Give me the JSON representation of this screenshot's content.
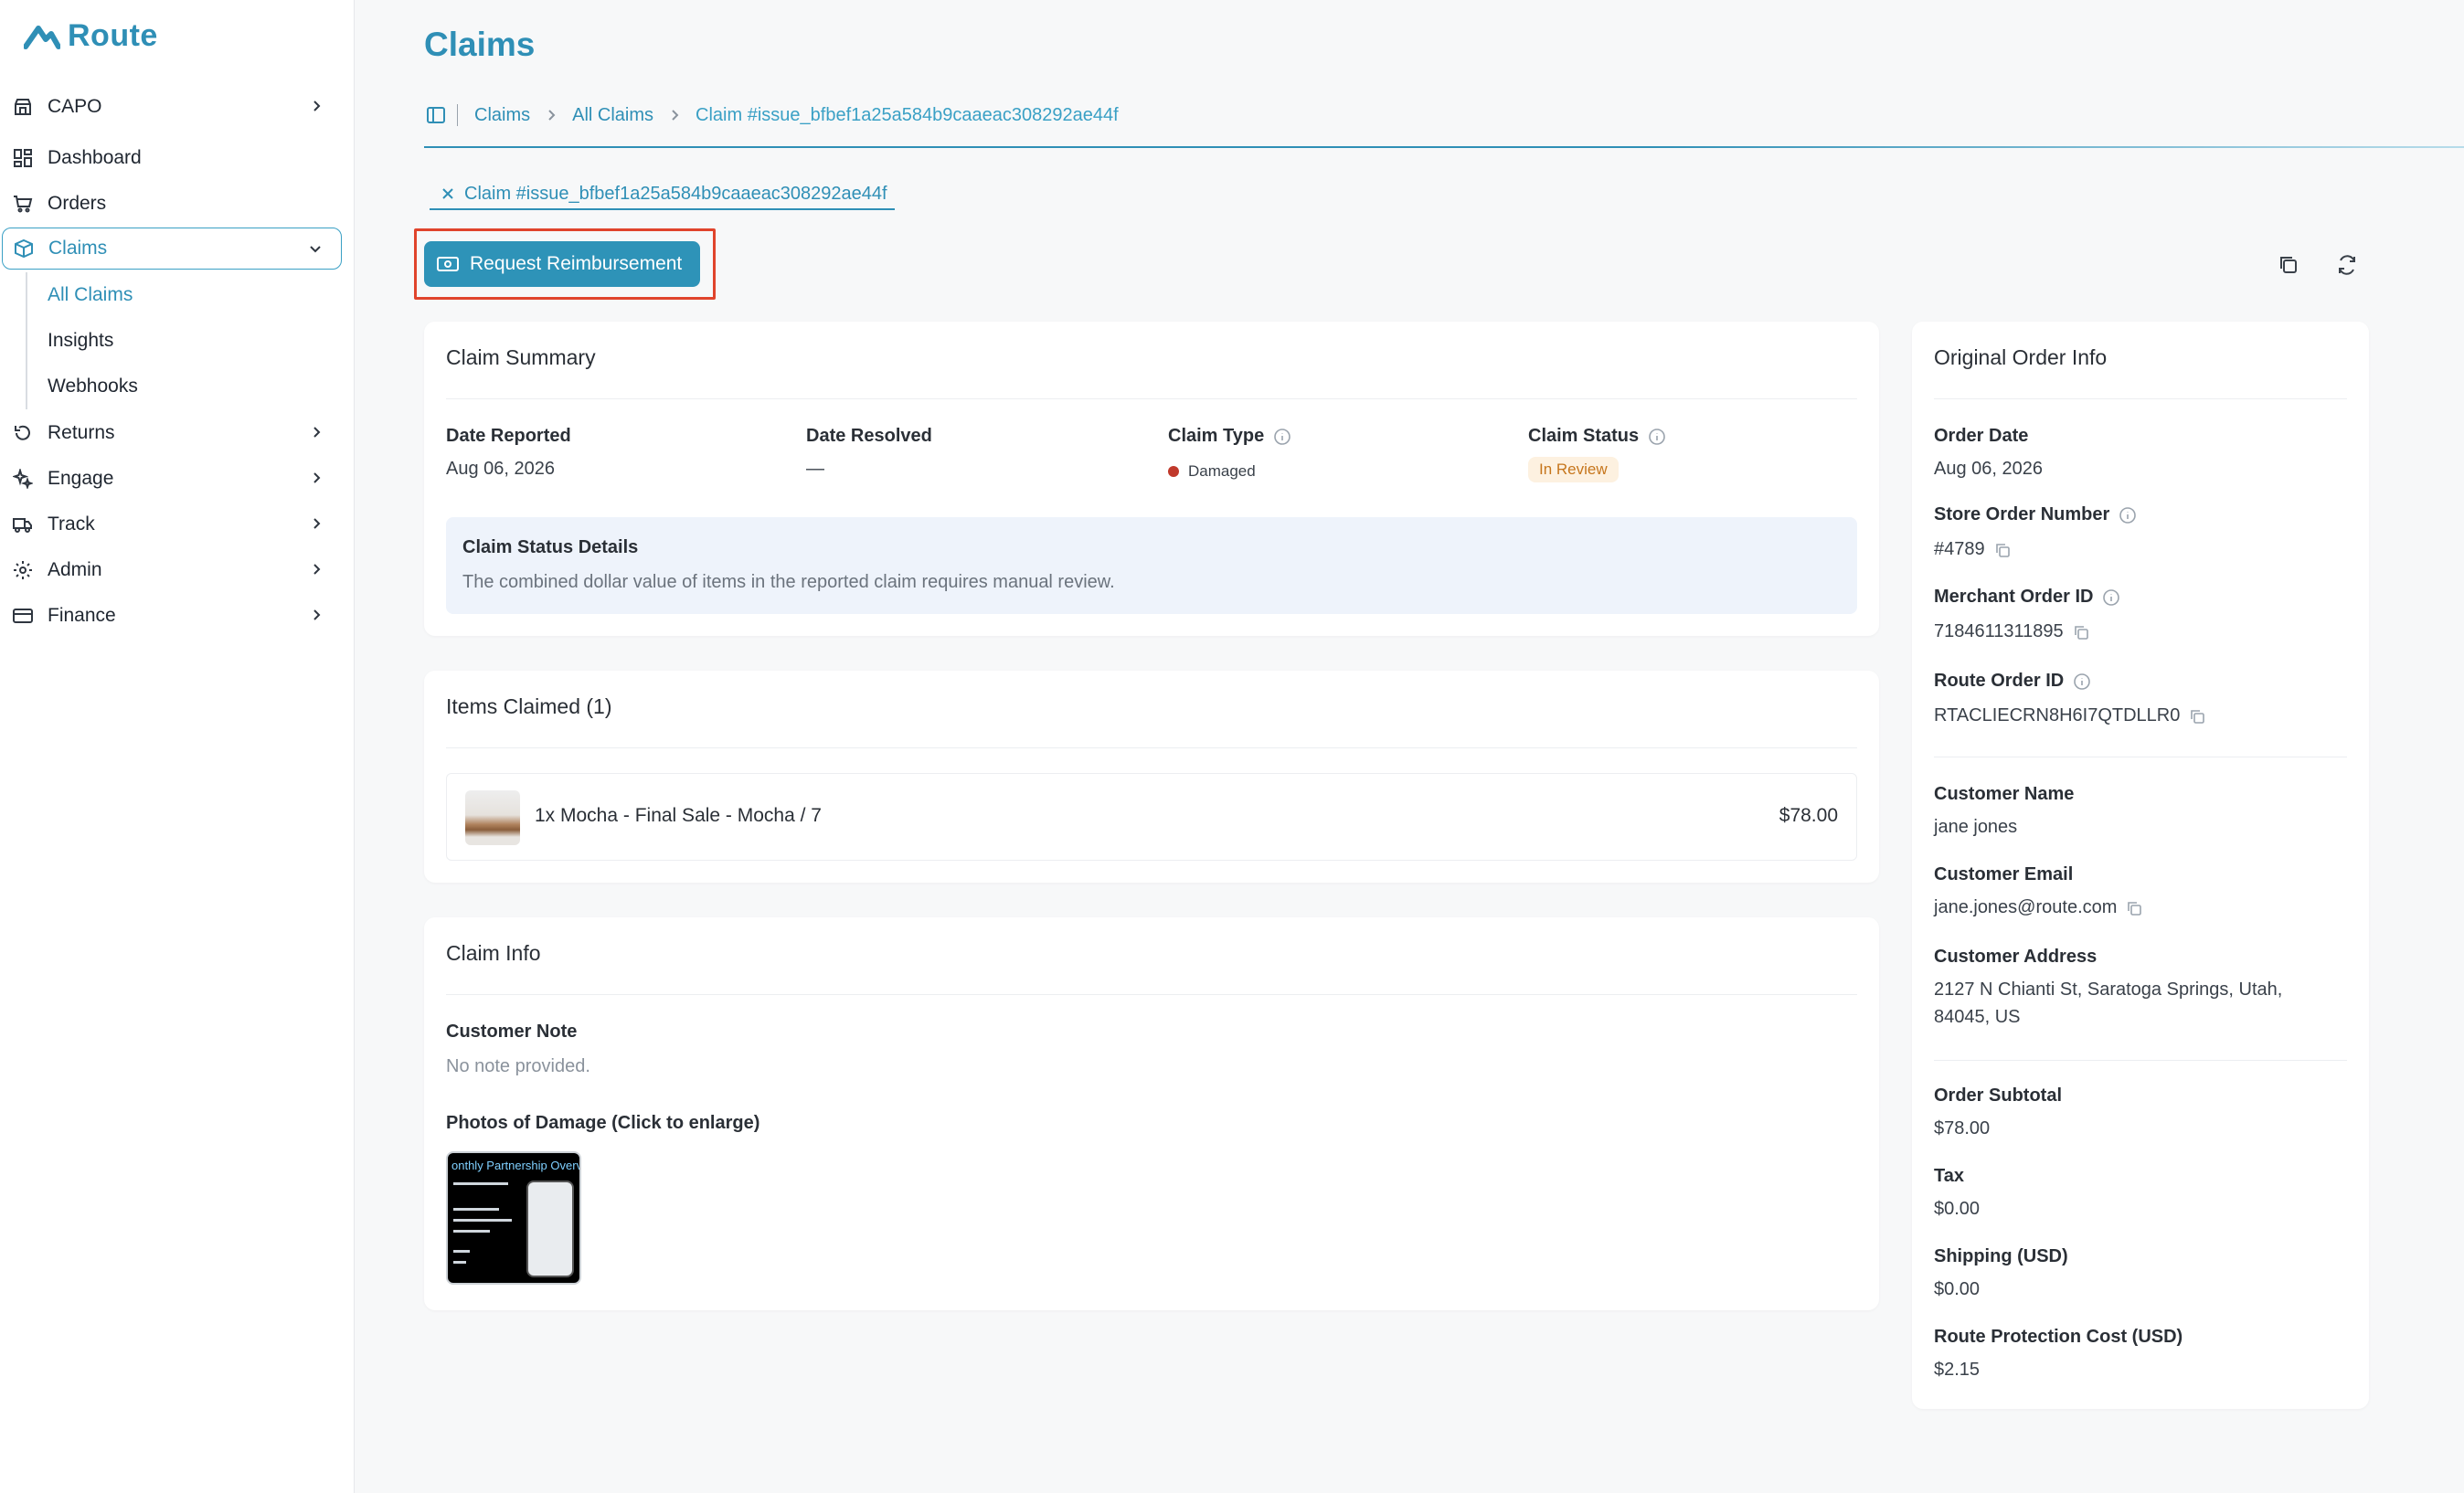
{
  "app": {
    "logo_text": "Route"
  },
  "sidebar": {
    "store": "CAPO",
    "items": [
      {
        "label": "Dashboard"
      },
      {
        "label": "Orders"
      },
      {
        "label": "Claims"
      },
      {
        "label": "Returns"
      },
      {
        "label": "Engage"
      },
      {
        "label": "Track"
      },
      {
        "label": "Admin"
      },
      {
        "label": "Finance"
      }
    ],
    "claims_sub": [
      {
        "label": "All Claims"
      },
      {
        "label": "Insights"
      },
      {
        "label": "Webhooks"
      }
    ]
  },
  "header": {
    "title": "Claims",
    "breadcrumb": [
      "Claims",
      "All Claims",
      "Claim #issue_bfbef1a25a584b9caaeac308292ae44f"
    ],
    "tab_label": "Claim #issue_bfbef1a25a584b9caaeac308292ae44f"
  },
  "actions": {
    "request_reimbursement": "Request Reimbursement"
  },
  "claim_summary": {
    "title": "Claim Summary",
    "date_reported_label": "Date Reported",
    "date_reported": "Aug 06, 2026",
    "date_resolved_label": "Date Resolved",
    "date_resolved": "—",
    "claim_type_label": "Claim Type",
    "claim_type": "Damaged",
    "claim_status_label": "Claim Status",
    "claim_status": "In Review",
    "status_details_title": "Claim Status Details",
    "status_details_text": "The combined dollar value of items in the reported claim requires manual review."
  },
  "items_claimed": {
    "title": "Items Claimed (1)",
    "items": [
      {
        "name": "1x Mocha - Final Sale - Mocha / 7",
        "price": "$78.00"
      }
    ]
  },
  "claim_info": {
    "title": "Claim Info",
    "customer_note_label": "Customer Note",
    "customer_note": "No note provided.",
    "photos_label": "Photos of Damage (Click to enlarge)",
    "photo_caption": "onthly Partnership Overview"
  },
  "order_info": {
    "title": "Original Order Info",
    "order_date_label": "Order Date",
    "order_date": "Aug 06, 2026",
    "store_order_number_label": "Store Order Number",
    "store_order_number": "#4789",
    "merchant_order_id_label": "Merchant Order ID",
    "merchant_order_id": "7184611311895",
    "route_order_id_label": "Route Order ID",
    "route_order_id": "RTACLIECRN8H6I7QTDLLR0",
    "customer_name_label": "Customer Name",
    "customer_name": "jane jones",
    "customer_email_label": "Customer Email",
    "customer_email": "jane.jones@route.com",
    "customer_address_label": "Customer Address",
    "customer_address_line1": "2127 N Chianti St, Saratoga Springs, Utah,",
    "customer_address_line2": "84045, US",
    "order_subtotal_label": "Order Subtotal",
    "order_subtotal": "$78.00",
    "tax_label": "Tax",
    "tax": "$0.00",
    "shipping_label": "Shipping (USD)",
    "shipping": "$0.00",
    "route_protection_label": "Route Protection Cost (USD)",
    "route_protection": "$2.15"
  },
  "colors": {
    "accent": "#2f8fb6",
    "button": "#2e93b8",
    "highlight_box": "#e0442c",
    "damaged_dot": "#c0392b",
    "in_review_bg": "#fdf1e0"
  }
}
